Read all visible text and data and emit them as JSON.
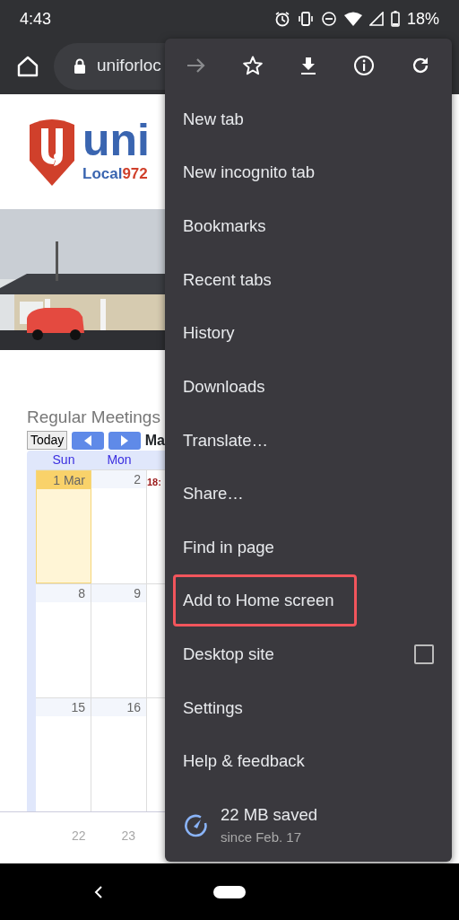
{
  "status_bar": {
    "time": "4:43",
    "battery": "18%"
  },
  "toolbar": {
    "url": "uniforloc"
  },
  "page": {
    "logo": {
      "wordmark": "uni",
      "local": "Local",
      "number": "972"
    },
    "calendar": {
      "title": "Regular Meetings",
      "today_button": "Today",
      "month": "Ma",
      "days": [
        "Sun",
        "Mon"
      ],
      "weeks": [
        {
          "days": [
            {
              "label": "1 Mar",
              "selected": true
            },
            {
              "label": "2",
              "selected": false
            }
          ],
          "event": "18:"
        },
        {
          "days": [
            {
              "label": "8",
              "selected": false
            },
            {
              "label": "9",
              "selected": false
            }
          ]
        },
        {
          "days": [
            {
              "label": "15",
              "selected": false
            },
            {
              "label": "16",
              "selected": false
            }
          ]
        }
      ],
      "faded_days": [
        "22",
        "23"
      ]
    }
  },
  "menu": {
    "actions": [
      {
        "kind": "forward",
        "disabled": true
      },
      {
        "kind": "star",
        "disabled": false
      },
      {
        "kind": "download",
        "disabled": false
      },
      {
        "kind": "info",
        "disabled": false
      },
      {
        "kind": "refresh",
        "disabled": false
      }
    ],
    "items": [
      {
        "label": "New tab",
        "kind": "plain",
        "highlighted": false
      },
      {
        "label": "New incognito tab",
        "kind": "plain",
        "highlighted": false
      },
      {
        "label": "Bookmarks",
        "kind": "plain",
        "highlighted": false
      },
      {
        "label": "Recent tabs",
        "kind": "plain",
        "highlighted": false
      },
      {
        "label": "History",
        "kind": "plain",
        "highlighted": false
      },
      {
        "label": "Downloads",
        "kind": "plain",
        "highlighted": false
      },
      {
        "label": "Translate…",
        "kind": "plain",
        "highlighted": false
      },
      {
        "label": "Share…",
        "kind": "plain",
        "highlighted": false
      },
      {
        "label": "Find in page",
        "kind": "plain",
        "highlighted": false
      },
      {
        "label": "Add to Home screen",
        "kind": "plain",
        "highlighted": true
      },
      {
        "label": "Desktop site",
        "kind": "checkbox",
        "checked": false,
        "highlighted": false
      },
      {
        "label": "Settings",
        "kind": "plain",
        "highlighted": false
      },
      {
        "label": "Help & feedback",
        "kind": "plain",
        "highlighted": false
      }
    ],
    "savings": {
      "title": "22 MB saved",
      "subtitle": "since Feb. 17"
    }
  }
}
